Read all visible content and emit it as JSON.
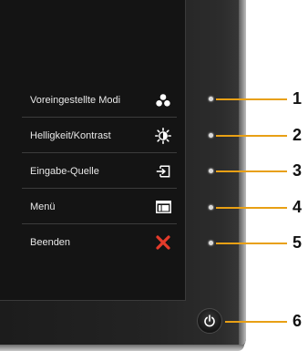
{
  "osd_menu": {
    "items": [
      {
        "label": "Voreingestellte Modi",
        "icon": "preset-modes-icon"
      },
      {
        "label": "Helligkeit/Kontrast",
        "icon": "brightness-contrast-icon"
      },
      {
        "label": "Eingabe-Quelle",
        "icon": "input-source-icon"
      },
      {
        "label": "Menü",
        "icon": "menu-icon"
      },
      {
        "label": "Beenden",
        "icon": "exit-icon"
      }
    ]
  },
  "callouts": [
    "1",
    "2",
    "3",
    "4",
    "5",
    "6"
  ],
  "colors": {
    "callout_line": "#e8a015",
    "exit_icon": "#e53b2b",
    "screen": "#141414"
  }
}
